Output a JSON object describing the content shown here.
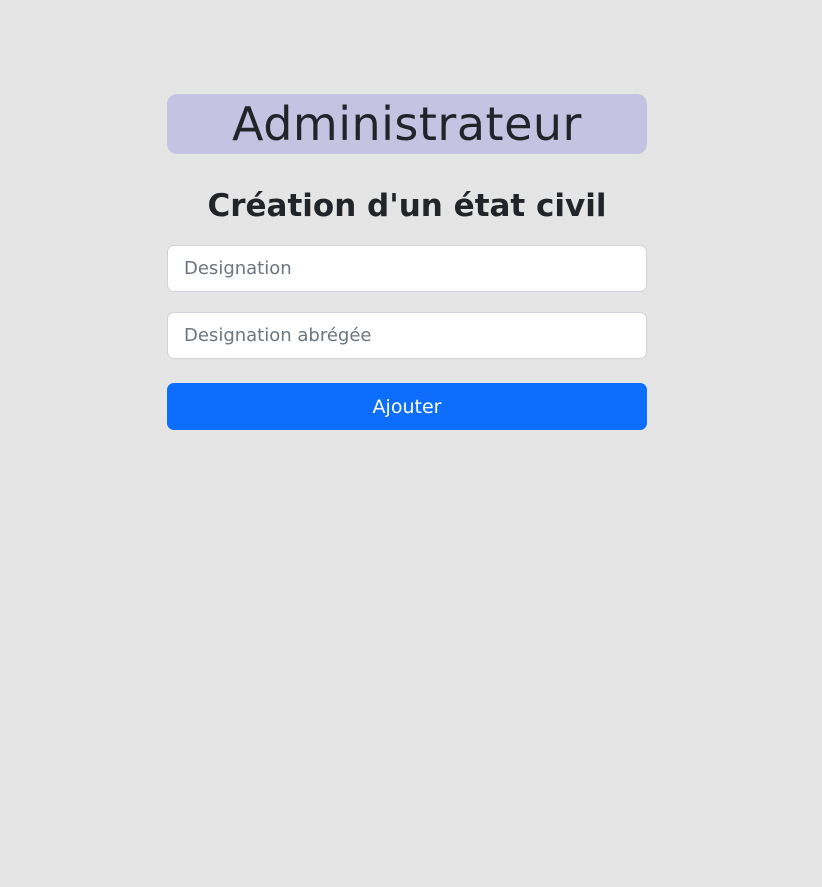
{
  "header": {
    "role": "Administrateur",
    "banner_color": "#c4c3e2"
  },
  "form": {
    "title": "Création d'un état civil",
    "designation": {
      "value": "",
      "placeholder": "Designation"
    },
    "designation_abbrev": {
      "value": "",
      "placeholder": "Designation abrégée"
    },
    "submit_label": "Ajouter",
    "submit_color": "#0d6efd"
  },
  "page": {
    "background": "#e5e5e5"
  }
}
